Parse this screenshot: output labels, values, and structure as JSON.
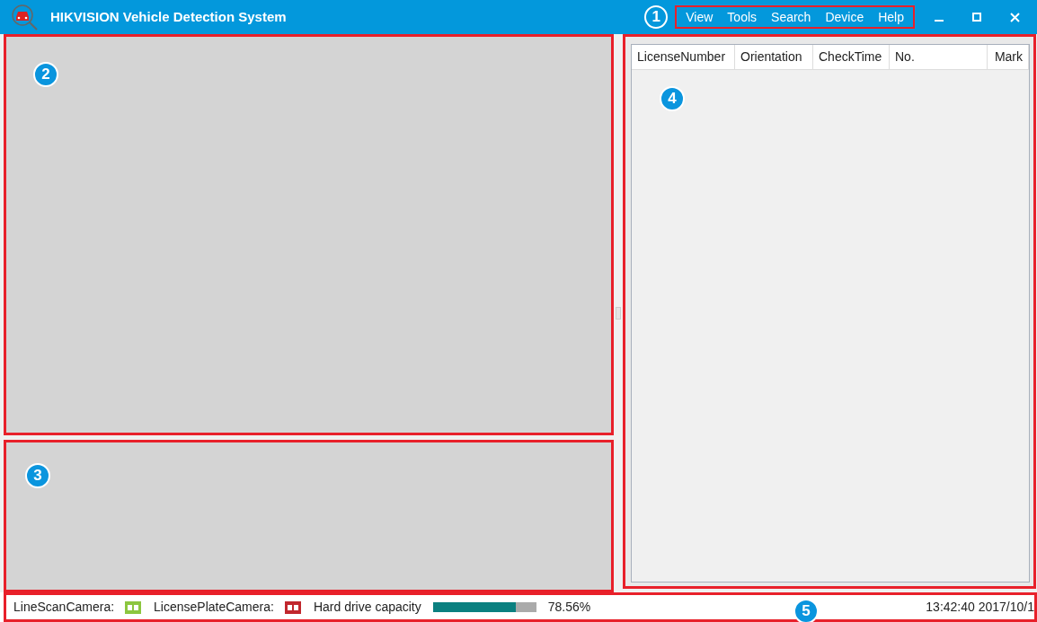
{
  "window": {
    "title": "HIKVISION Vehicle Detection System",
    "callout": "1"
  },
  "menu": [
    "View",
    "Tools",
    "Search",
    "Device",
    "Help"
  ],
  "video_panel": {
    "callout": "2"
  },
  "lower_panel": {
    "callout": "3"
  },
  "table": {
    "callout": "4",
    "columns": [
      "LicenseNumber",
      "Orientation",
      "CheckTime",
      "No.",
      "Mark"
    ]
  },
  "status_bar": {
    "callout": "5",
    "cameras": [
      {
        "label": "LineScanCamera:",
        "color": "#8cc63f"
      },
      {
        "label": "LicensePlateCamera:",
        "color": "#c1272d"
      }
    ],
    "disk": {
      "label": "Hard drive capacity",
      "level": 0.8,
      "reading": "78.56%"
    },
    "time": "13:42:40 2017/10/1"
  }
}
